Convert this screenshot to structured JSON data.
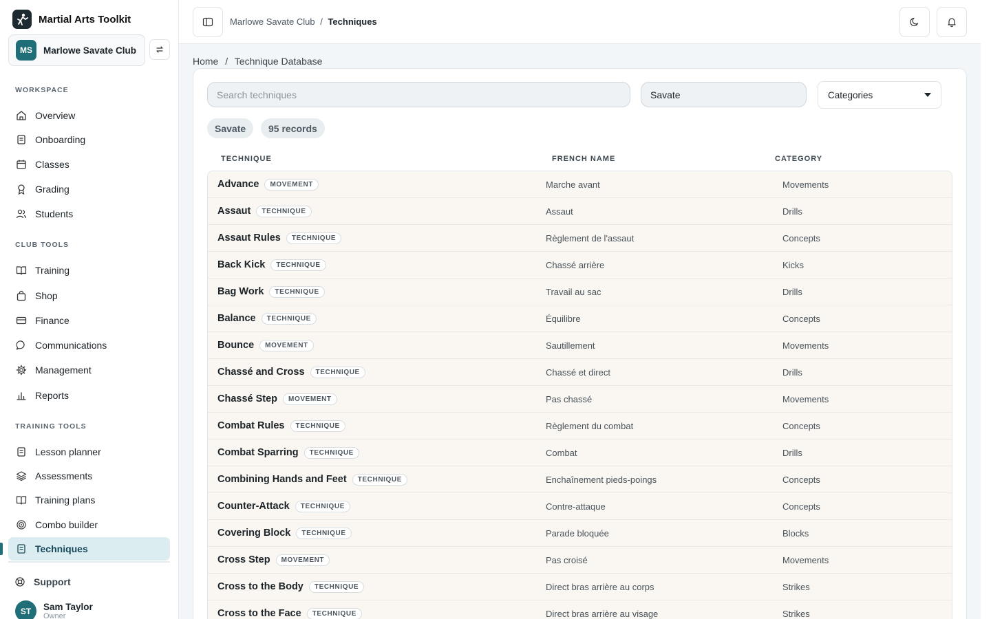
{
  "app": {
    "title": "Martial Arts Toolkit"
  },
  "club": {
    "initials": "MS",
    "name": "Marlowe Savate Club"
  },
  "sidebar": {
    "workspace_label": "WORKSPACE",
    "workspace": [
      {
        "label": "Overview",
        "icon": "home-icon"
      },
      {
        "label": "Onboarding",
        "icon": "clipboard-icon"
      },
      {
        "label": "Classes",
        "icon": "calendar-icon"
      },
      {
        "label": "Grading",
        "icon": "ribbon-icon"
      },
      {
        "label": "Students",
        "icon": "users-icon"
      }
    ],
    "club_tools_label": "CLUB TOOLS",
    "club_tools": [
      {
        "label": "Training",
        "icon": "book-icon"
      },
      {
        "label": "Shop",
        "icon": "shopping-bag-icon"
      },
      {
        "label": "Finance",
        "icon": "credit-card-icon"
      },
      {
        "label": "Communications",
        "icon": "chat-icon"
      },
      {
        "label": "Management",
        "icon": "gear-icon"
      },
      {
        "label": "Reports",
        "icon": "bar-chart-icon"
      }
    ],
    "training_tools_label": "TRAINING TOOLS",
    "training_tools": [
      {
        "label": "Lesson planner",
        "icon": "clipboard-icon"
      },
      {
        "label": "Assessments",
        "icon": "layers-icon"
      },
      {
        "label": "Training plans",
        "icon": "book-icon"
      },
      {
        "label": "Combo builder",
        "icon": "target-icon"
      },
      {
        "label": "Techniques",
        "icon": "document-icon",
        "active": true
      }
    ],
    "support": "Support",
    "user": {
      "initials": "ST",
      "name": "Sam Taylor",
      "role": "Owner"
    }
  },
  "topbar": {
    "club": "Marlowe Savate Club",
    "separator": "/",
    "page": "Techniques"
  },
  "breadcrumb": {
    "home": "Home",
    "separator": "/",
    "current": "Technique Database"
  },
  "filters": {
    "search_placeholder": "Search techniques",
    "art_value": "Savate",
    "categories_label": "Categories",
    "chip_art": "Savate",
    "chip_count": "95 records"
  },
  "table": {
    "headers": [
      "TECHNIQUE",
      "FRENCH NAME",
      "CATEGORY"
    ],
    "rows": [
      {
        "name": "Advance",
        "tag": "MOVEMENT",
        "french": "Marche avant",
        "category": "Movements"
      },
      {
        "name": "Assaut",
        "tag": "TECHNIQUE",
        "french": "Assaut",
        "category": "Drills"
      },
      {
        "name": "Assaut Rules",
        "tag": "TECHNIQUE",
        "french": "Règlement de l'assaut",
        "category": "Concepts"
      },
      {
        "name": "Back Kick",
        "tag": "TECHNIQUE",
        "french": "Chassé arrière",
        "category": "Kicks"
      },
      {
        "name": "Bag Work",
        "tag": "TECHNIQUE",
        "french": "Travail au sac",
        "category": "Drills"
      },
      {
        "name": "Balance",
        "tag": "TECHNIQUE",
        "french": "Équilibre",
        "category": "Concepts"
      },
      {
        "name": "Bounce",
        "tag": "MOVEMENT",
        "french": "Sautillement",
        "category": "Movements"
      },
      {
        "name": "Chassé and Cross",
        "tag": "TECHNIQUE",
        "french": "Chassé et direct",
        "category": "Drills"
      },
      {
        "name": "Chassé Step",
        "tag": "MOVEMENT",
        "french": "Pas chassé",
        "category": "Movements"
      },
      {
        "name": "Combat Rules",
        "tag": "TECHNIQUE",
        "french": "Règlement du combat",
        "category": "Concepts"
      },
      {
        "name": "Combat Sparring",
        "tag": "TECHNIQUE",
        "french": "Combat",
        "category": "Drills"
      },
      {
        "name": "Combining Hands and Feet",
        "tag": "TECHNIQUE",
        "french": "Enchaînement pieds-poings",
        "category": "Concepts"
      },
      {
        "name": "Counter-Attack",
        "tag": "TECHNIQUE",
        "french": "Contre-attaque",
        "category": "Concepts"
      },
      {
        "name": "Covering Block",
        "tag": "TECHNIQUE",
        "french": "Parade bloquée",
        "category": "Blocks"
      },
      {
        "name": "Cross Step",
        "tag": "MOVEMENT",
        "french": "Pas croisé",
        "category": "Movements"
      },
      {
        "name": "Cross to the Body",
        "tag": "TECHNIQUE",
        "french": "Direct bras arrière au corps",
        "category": "Strikes"
      },
      {
        "name": "Cross to the Face",
        "tag": "TECHNIQUE",
        "french": "Direct bras arrière au visage",
        "category": "Strikes"
      }
    ]
  },
  "colors": {
    "accent": "#1f6e78",
    "active_bg": "#dcedf2",
    "row_bg": "#faf7f2"
  }
}
